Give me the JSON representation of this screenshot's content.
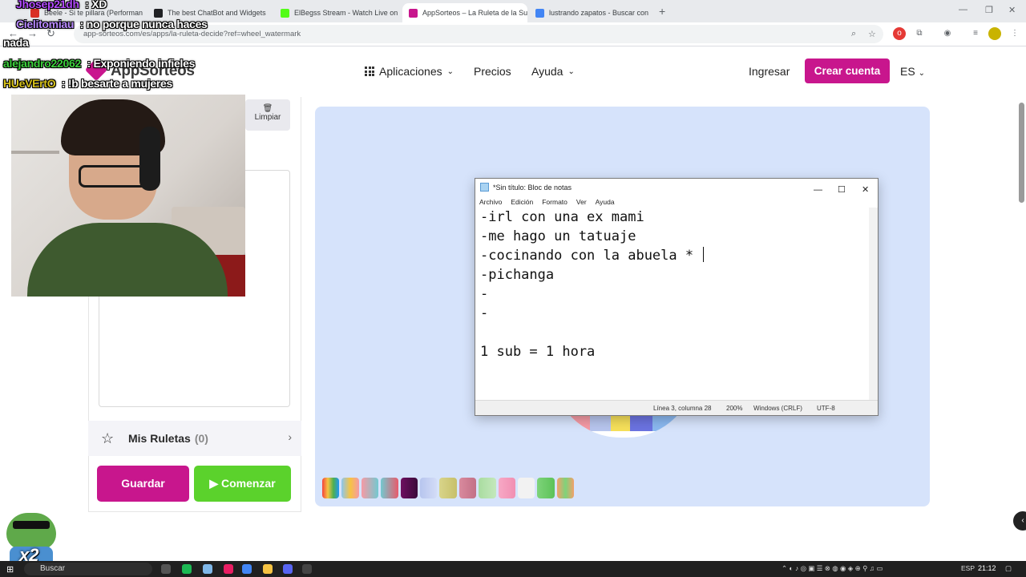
{
  "browser": {
    "tabs": [
      {
        "label": "Beele - Si te pillara (Performan",
        "color": "#d93025"
      },
      {
        "label": "The best ChatBot and Widgets",
        "color": "#202124"
      },
      {
        "label": "ElBegss Stream - Watch Live on",
        "color": "#53fc18"
      },
      {
        "label": "AppSorteos – La Ruleta de la Su",
        "color": "#c8168d"
      },
      {
        "label": "lustrando zapatos - Buscar con",
        "color": "#4285f4"
      }
    ],
    "url": "app-sorteos.com/es/apps/la-ruleta-decide?ref=wheel_watermark"
  },
  "site": {
    "logo": "AppSorteos",
    "nav": {
      "apps": "Aplicaciones",
      "prices": "Precios",
      "help": "Ayuda"
    },
    "signin": "Ingresar",
    "create_account": "Crear cuenta",
    "lang": "ES"
  },
  "panel": {
    "clear": "Limpiar",
    "my_roulettes": "Mis Ruletas",
    "my_roulettes_count": "(0)",
    "save": "Guardar",
    "start": "Comenzar"
  },
  "palette": [
    "#f6c343",
    "#8bc6f0",
    "#f59aa5",
    "#73c9d0",
    "#6e1060",
    "#b7c5ee",
    "#d8d48a",
    "#d98a9e",
    "#a9dca0",
    "#f7a8c5",
    "#f2f2f2",
    "#7ed37a",
    "#f2a06a"
  ],
  "notepad": {
    "title": "*Sin título: Bloc de notas",
    "menu": [
      "Archivo",
      "Edición",
      "Formato",
      "Ver",
      "Ayuda"
    ],
    "lines": [
      "-irl con una ex mami",
      "-me hago un tatuaje",
      "-cocinando con la abuela * ",
      "-pichanga",
      "-",
      "-",
      "",
      "1 sub = 1 hora"
    ],
    "status": {
      "position": "Línea 3, columna 28",
      "zoom": "200%",
      "eol": "Windows (CRLF)",
      "encoding": "UTF-8"
    }
  },
  "chat": [
    {
      "user": "Jhosep21dh",
      "sep": " : ",
      "msg": "XD",
      "color": "#b44cff"
    },
    {
      "user": "Cielitomiau",
      "sep": " : ",
      "msg": "no porque nunca haces",
      "color": "#b98aff"
    },
    {
      "user": "",
      "sep": "",
      "msg": "nada",
      "color": "#ffffff"
    },
    {
      "user": "alejandro22062",
      "sep": " : ",
      "msg": "Exponiendo infieles",
      "color": "#3dd13d"
    },
    {
      "user": "HUeVErtO",
      "sep": " : ",
      "msg": "!b besarte a mujeres",
      "color": "#d6c11a"
    }
  ],
  "overlay": {
    "multiplier": "x2"
  },
  "taskbar": {
    "search": "Buscar",
    "lang": "ESP",
    "time": "21:12"
  }
}
